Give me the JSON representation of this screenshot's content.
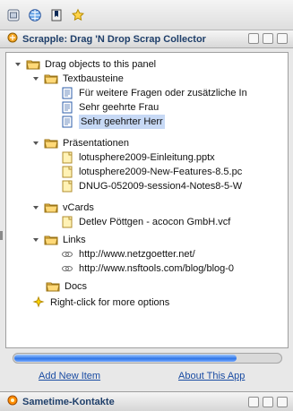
{
  "toolbar": {
    "icons": [
      "mail-icon",
      "globe-icon",
      "bookmark-icon",
      "star-icon"
    ]
  },
  "panel": {
    "title": "Scrapple: Drag 'N Drop Scrap Collector",
    "icon": "scrapple-app-icon"
  },
  "tree": {
    "root": {
      "label": "Drag objects to this panel",
      "icon": "folder-open-icon",
      "expanded": true
    },
    "groups": [
      {
        "label": "Textbausteine",
        "icon": "folder-open-icon",
        "items": [
          {
            "label": "Für weitere Fragen oder zusätzliche In",
            "icon": "document-icon"
          },
          {
            "label": "Sehr geehrte Frau",
            "icon": "document-icon"
          },
          {
            "label": "Sehr geehrter Herr",
            "icon": "document-icon",
            "selected": true
          }
        ]
      },
      {
        "label": "Präsentationen",
        "icon": "folder-open-icon",
        "items": [
          {
            "label": "lotusphere2009-Einleitung.pptx",
            "icon": "file-icon"
          },
          {
            "label": "lotusphere2009-New-Features-8.5.pc",
            "icon": "file-icon"
          },
          {
            "label": "DNUG-052009-session4-Notes8-5-W",
            "icon": "file-icon"
          }
        ]
      },
      {
        "label": "vCards",
        "icon": "folder-open-icon",
        "items": [
          {
            "label": "Detlev Pöttgen - acocon GmbH.vcf",
            "icon": "file-icon"
          }
        ]
      },
      {
        "label": "Links",
        "icon": "folder-open-icon",
        "items": [
          {
            "label": "http://www.netzgoetter.net/",
            "icon": "link-icon"
          },
          {
            "label": "http://www.nsftools.com/blog/blog-0",
            "icon": "link-icon"
          }
        ]
      },
      {
        "label": "Docs",
        "icon": "folder-open-icon",
        "items": []
      }
    ],
    "hint": {
      "label": "Right-click for more options",
      "icon": "sparkle-icon"
    }
  },
  "scrollbar": {
    "position_fraction": 0.83
  },
  "links": {
    "add_new_item": "Add New Item",
    "about_this_app": "About This App"
  },
  "footer": {
    "title": "Sametime-Kontakte",
    "icon": "sametime-icon"
  },
  "colors": {
    "title_text": "#1f3f6a",
    "link": "#1a4ca3",
    "selection": "#c7d9f5",
    "scroll_thumb": "#2f76e8"
  }
}
